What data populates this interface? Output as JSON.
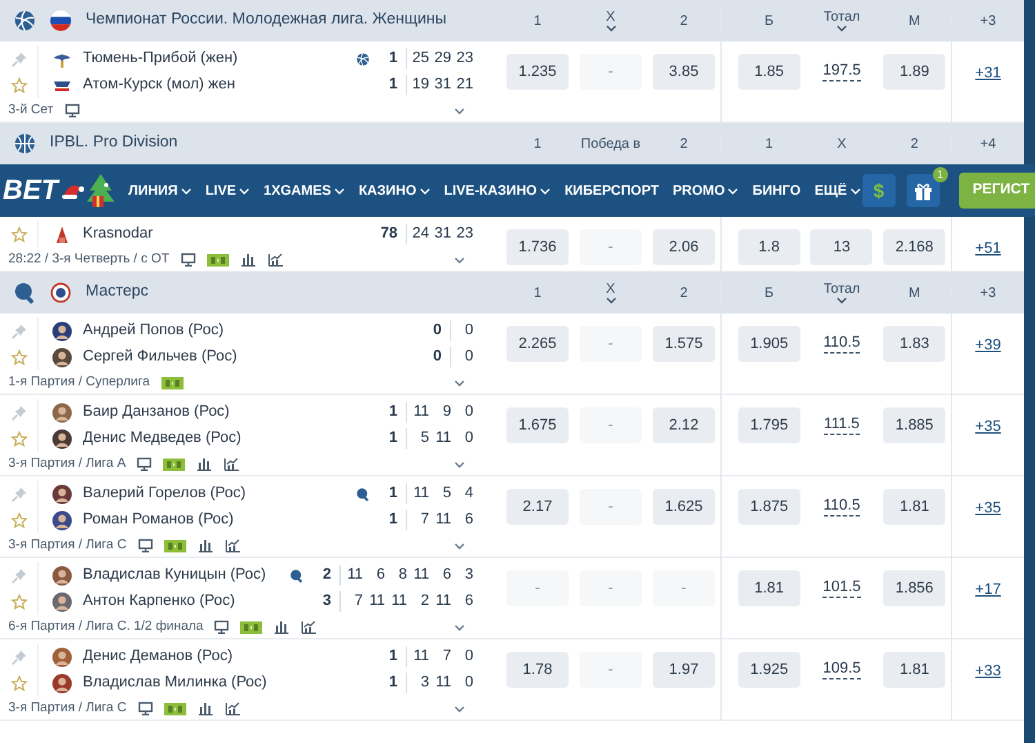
{
  "sections": [
    {
      "sport_icon": {
        "kind": "volleyball"
      },
      "emblem": {
        "kind": "flag"
      },
      "title": "Чемпионат России. Молодежная лига. Женщины",
      "columns": [
        {
          "label": "1",
          "dropdown": false
        },
        {
          "label": "X",
          "dropdown": true
        },
        {
          "label": "2",
          "dropdown": false
        },
        {
          "label": "Б",
          "dropdown": false
        },
        {
          "label": "Тотал",
          "dropdown": true
        },
        {
          "label": "M",
          "dropdown": false
        },
        {
          "label": "+3",
          "dropdown": false
        }
      ],
      "matches": [
        {
          "teams": [
            {
              "action": {
                "kind": "pin"
              },
              "logo": {
                "kind": "crest"
              },
              "name": "Тюмень-Прибой (жен)",
              "serve": true,
              "score": "1",
              "sets": [
                "25",
                "29",
                "23"
              ]
            },
            {
              "action": {
                "kind": "star"
              },
              "logo": {
                "kind": "crest"
              },
              "name": "Атом-Курск (мол) жен",
              "serve": false,
              "score": "1",
              "sets": [
                "19",
                "31",
                "21"
              ]
            }
          ],
          "info": "3-й Сет",
          "icons": [
            {
              "kind": "tv"
            }
          ],
          "odds": [
            {
              "kind": "odd",
              "value": "1.235"
            },
            {
              "kind": "dash",
              "value": "-"
            },
            {
              "kind": "odd",
              "value": "3.85"
            },
            {
              "kind": "odd",
              "value": "1.85"
            },
            {
              "kind": "total",
              "value": "197.5"
            },
            {
              "kind": "odd",
              "value": "1.89"
            }
          ],
          "more": "+31"
        }
      ]
    },
    {
      "sport_icon": {
        "kind": "basketball"
      },
      "title": "IPBL. Pro Division",
      "columns": [
        {
          "label": "1",
          "dropdown": false
        },
        {
          "label": "Победа в",
          "dropdown": false
        },
        {
          "label": "2",
          "dropdown": false
        },
        {
          "label": "1",
          "dropdown": false
        },
        {
          "label": "X",
          "dropdown": false
        },
        {
          "label": "2",
          "dropdown": false
        },
        {
          "label": "+4",
          "dropdown": false
        }
      ],
      "matches": [
        {
          "teams": [
            {
              "action": {
                "kind": "star"
              },
              "logo": {
                "kind": "crest"
              },
              "name": "Krasnodar",
              "serve": false,
              "score": "78",
              "sets": [
                "24",
                "31",
                "23"
              ]
            }
          ],
          "info": "28:22 / 3-я Четверть / с ОТ",
          "icons": [
            {
              "kind": "tv"
            },
            {
              "kind": "score"
            },
            {
              "kind": "stats"
            },
            {
              "kind": "lineup"
            }
          ],
          "odds": [
            {
              "kind": "odd",
              "value": "1.736"
            },
            {
              "kind": "dash",
              "value": "-"
            },
            {
              "kind": "odd",
              "value": "2.06"
            },
            {
              "kind": "odd",
              "value": "1.8"
            },
            {
              "kind": "odd",
              "value": "13"
            },
            {
              "kind": "odd",
              "value": "2.168"
            }
          ],
          "more": "+51"
        }
      ]
    },
    {
      "sport_icon": {
        "kind": "table-tennis"
      },
      "emblem": {
        "kind": "league"
      },
      "title": "Мастерс",
      "columns": [
        {
          "label": "1",
          "dropdown": false
        },
        {
          "label": "X",
          "dropdown": true
        },
        {
          "label": "2",
          "dropdown": false
        },
        {
          "label": "Б",
          "dropdown": false
        },
        {
          "label": "Тотал",
          "dropdown": true
        },
        {
          "label": "M",
          "dropdown": false
        },
        {
          "label": "+3",
          "dropdown": false
        }
      ],
      "matches": [
        {
          "teams": [
            {
              "action": {
                "kind": "pin"
              },
              "logo": {
                "kind": "player"
              },
              "name": "Андрей Попов (Рос)",
              "serve": false,
              "score": "0",
              "sets": [
                "0"
              ]
            },
            {
              "action": {
                "kind": "star"
              },
              "logo": {
                "kind": "player"
              },
              "name": "Сергей Фильчев (Рос)",
              "serve": false,
              "score": "0",
              "sets": [
                "0"
              ]
            }
          ],
          "info": "1-я Партия / Суперлига",
          "icons": [
            {
              "kind": "score"
            }
          ],
          "odds": [
            {
              "kind": "odd",
              "value": "2.265"
            },
            {
              "kind": "dash",
              "value": "-"
            },
            {
              "kind": "odd",
              "value": "1.575"
            },
            {
              "kind": "odd",
              "value": "1.905"
            },
            {
              "kind": "total",
              "value": "110.5"
            },
            {
              "kind": "odd",
              "value": "1.83"
            }
          ],
          "more": "+39"
        },
        {
          "teams": [
            {
              "action": {
                "kind": "pin"
              },
              "logo": {
                "kind": "player"
              },
              "name": "Баир Данзанов (Рос)",
              "serve": false,
              "score": "1",
              "sets": [
                "11",
                "9",
                "0"
              ]
            },
            {
              "action": {
                "kind": "star"
              },
              "logo": {
                "kind": "player"
              },
              "name": "Денис Медведев (Рос)",
              "serve": false,
              "score": "1",
              "sets": [
                "5",
                "11",
                "0"
              ]
            }
          ],
          "info": "3-я Партия / Лига А",
          "icons": [
            {
              "kind": "tv"
            },
            {
              "kind": "score"
            },
            {
              "kind": "stats"
            },
            {
              "kind": "lineup"
            }
          ],
          "odds": [
            {
              "kind": "odd",
              "value": "1.675"
            },
            {
              "kind": "dash",
              "value": "-"
            },
            {
              "kind": "odd",
              "value": "2.12"
            },
            {
              "kind": "odd",
              "value": "1.795"
            },
            {
              "kind": "total",
              "value": "111.5"
            },
            {
              "kind": "odd",
              "value": "1.885"
            }
          ],
          "more": "+35"
        },
        {
          "teams": [
            {
              "action": {
                "kind": "pin"
              },
              "logo": {
                "kind": "player"
              },
              "name": "Валерий Горелов (Рос)",
              "serve": true,
              "score": "1",
              "sets": [
                "11",
                "5",
                "4"
              ]
            },
            {
              "action": {
                "kind": "star"
              },
              "logo": {
                "kind": "player"
              },
              "name": "Роман Романов (Рос)",
              "serve": false,
              "score": "1",
              "sets": [
                "7",
                "11",
                "6"
              ]
            }
          ],
          "info": "3-я Партия / Лига С",
          "icons": [
            {
              "kind": "tv"
            },
            {
              "kind": "score"
            },
            {
              "kind": "stats"
            },
            {
              "kind": "lineup"
            }
          ],
          "odds": [
            {
              "kind": "odd",
              "value": "2.17"
            },
            {
              "kind": "dash",
              "value": "-"
            },
            {
              "kind": "odd",
              "value": "1.625"
            },
            {
              "kind": "odd",
              "value": "1.875"
            },
            {
              "kind": "total",
              "value": "110.5"
            },
            {
              "kind": "odd",
              "value": "1.81"
            }
          ],
          "more": "+35"
        },
        {
          "teams": [
            {
              "action": {
                "kind": "pin"
              },
              "logo": {
                "kind": "player"
              },
              "name": "Владислав Куницын (Рос)",
              "serve": true,
              "score": "2",
              "sets": [
                "11",
                "6",
                "8",
                "11",
                "6",
                "3"
              ]
            },
            {
              "action": {
                "kind": "star"
              },
              "logo": {
                "kind": "player"
              },
              "name": "Антон Карпенко (Рос)",
              "serve": false,
              "score": "3",
              "sets": [
                "7",
                "11",
                "11",
                "2",
                "11",
                "6"
              ]
            }
          ],
          "info": "6-я Партия / Лига С. 1/2 финала",
          "icons": [
            {
              "kind": "tv"
            },
            {
              "kind": "score"
            },
            {
              "kind": "stats"
            },
            {
              "kind": "lineup"
            }
          ],
          "odds": [
            {
              "kind": "dash",
              "value": "-"
            },
            {
              "kind": "dash",
              "value": "-"
            },
            {
              "kind": "dash",
              "value": "-"
            },
            {
              "kind": "odd",
              "value": "1.81"
            },
            {
              "kind": "total",
              "value": "101.5"
            },
            {
              "kind": "odd",
              "value": "1.856"
            }
          ],
          "more": "+17"
        },
        {
          "teams": [
            {
              "action": {
                "kind": "pin"
              },
              "logo": {
                "kind": "player"
              },
              "name": "Денис Деманов (Рос)",
              "serve": false,
              "score": "1",
              "sets": [
                "11",
                "7",
                "0"
              ]
            },
            {
              "action": {
                "kind": "star"
              },
              "logo": {
                "kind": "player"
              },
              "name": "Владислав Милинка (Рос)",
              "serve": false,
              "score": "1",
              "sets": [
                "3",
                "11",
                "0"
              ]
            }
          ],
          "info": "3-я Партия / Лига С",
          "icons": [
            {
              "kind": "tv"
            },
            {
              "kind": "score"
            },
            {
              "kind": "stats"
            },
            {
              "kind": "lineup"
            }
          ],
          "odds": [
            {
              "kind": "odd",
              "value": "1.78"
            },
            {
              "kind": "dash",
              "value": "-"
            },
            {
              "kind": "odd",
              "value": "1.97"
            },
            {
              "kind": "odd",
              "value": "1.925"
            },
            {
              "kind": "total",
              "value": "109.5"
            },
            {
              "kind": "odd",
              "value": "1.81"
            }
          ],
          "more": "+33"
        }
      ]
    }
  ],
  "navbar": {
    "logo": "BET",
    "items": [
      {
        "label": "ЛИНИЯ",
        "dropdown": true
      },
      {
        "label": "LIVE",
        "dropdown": true
      },
      {
        "label": "1XGAMES",
        "dropdown": true
      },
      {
        "label": "КАЗИНО",
        "dropdown": true
      },
      {
        "label": "LIVE-КАЗИНО",
        "dropdown": true
      },
      {
        "label": "КИБЕРСПОРТ",
        "dropdown": false
      },
      {
        "label": "PROMO",
        "dropdown": true
      },
      {
        "label": "БИНГО",
        "dropdown": false
      },
      {
        "label": "ЕЩЁ",
        "dropdown": true
      }
    ],
    "deposit": "$",
    "gift_badge": "1",
    "register": "РЕГИСТ"
  }
}
